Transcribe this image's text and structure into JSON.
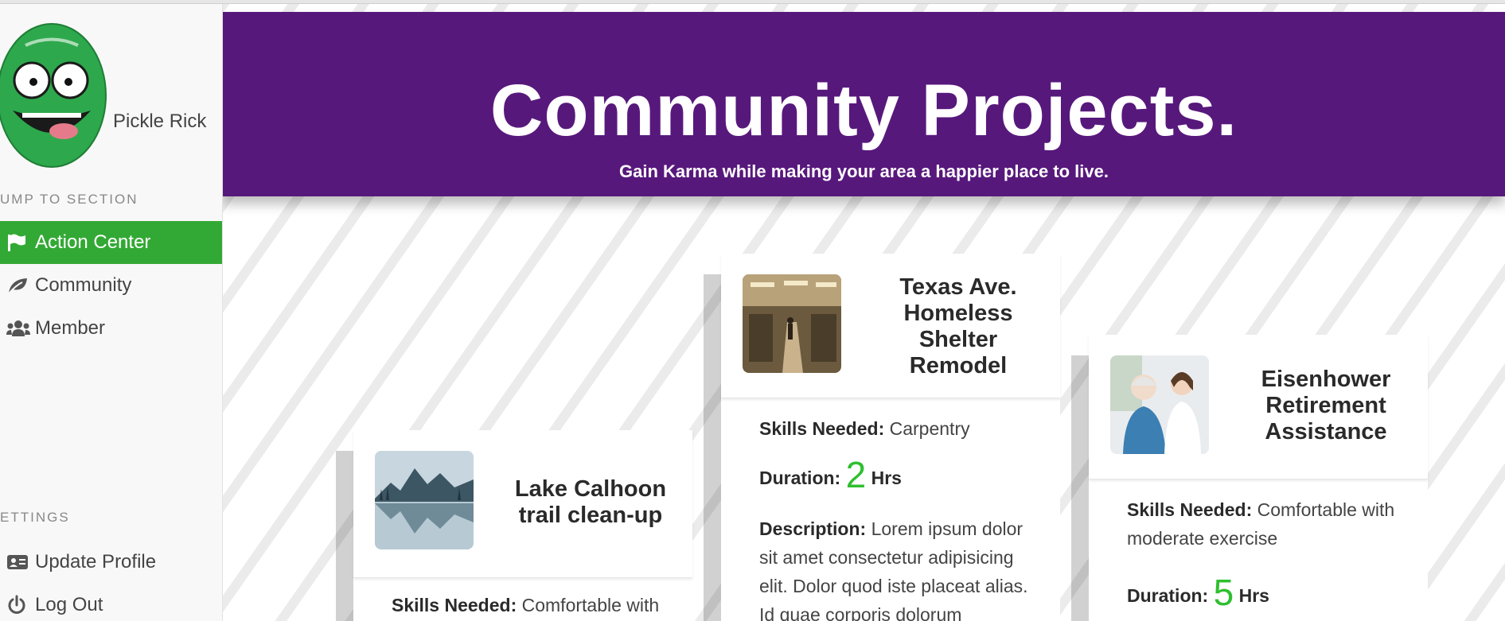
{
  "user": {
    "name": "Pickle Rick"
  },
  "sidebar": {
    "jump_label": "UMP TO SECTION",
    "items": [
      {
        "label": "Action Center",
        "icon": "flag-icon",
        "active": true
      },
      {
        "label": "Community",
        "icon": "leaf-icon",
        "active": false
      },
      {
        "label": "Member",
        "icon": "users-icon",
        "active": false
      }
    ],
    "settings_label": "ETTINGS",
    "settings_items": [
      {
        "label": "Update Profile",
        "icon": "id-card-icon"
      },
      {
        "label": "Log Out",
        "icon": "power-icon"
      }
    ]
  },
  "hero": {
    "title": "Community Projects.",
    "subtitle": "Gain Karma while making your area a happier place to live."
  },
  "projects": [
    {
      "title": "Lake Calhoon trail clean-up",
      "skills_label": "Skills Needed:",
      "skills": "Comfortable with"
    },
    {
      "title": "Texas Ave. Homeless Shelter Remodel",
      "skills_label": "Skills Needed:",
      "skills": "Carpentry",
      "duration_label": "Duration:",
      "duration_value": "2",
      "duration_unit": "Hrs",
      "description_label": "Description:",
      "description": "Lorem ipsum dolor sit amet consectetur adipisicing elit. Dolor quod iste placeat alias. Id quae corporis dolorum"
    },
    {
      "title": "Eisenhower Retirement Assistance",
      "skills_label": "Skills Needed:",
      "skills": "Comfortable with moderate exercise",
      "duration_label": "Duration:",
      "duration_value": "5",
      "duration_unit": "Hrs"
    }
  ],
  "colors": {
    "brand_purple": "#57187c",
    "active_green": "#33a935",
    "accent_green": "#2fbf2f"
  }
}
